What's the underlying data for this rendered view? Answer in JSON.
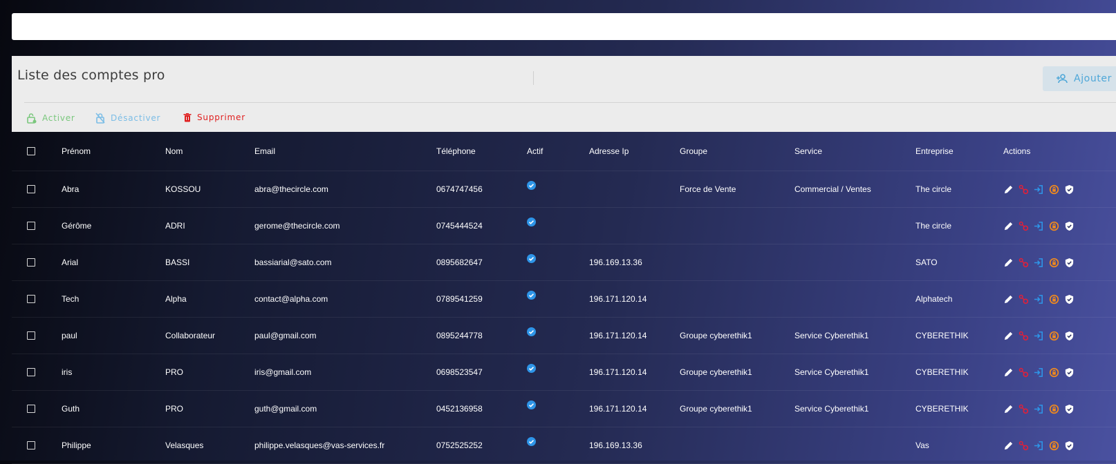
{
  "page": {
    "title": "Liste des comptes pro",
    "add_label": "Ajouter",
    "bulk_actions": {
      "activate": "Activer",
      "deactivate": "Désactiver",
      "delete": "Supprimer"
    }
  },
  "colors": {
    "accent_blue": "#4ea7d8",
    "activate_green": "#7ac77d",
    "delete_red": "#e01e1e",
    "check_blue": "#2e95e8",
    "action_orange": "#f08a1d"
  },
  "table": {
    "headers": {
      "first": "Prénom",
      "last": "Nom",
      "email": "Email",
      "phone": "Téléphone",
      "actif": "Actif",
      "ip": "Adresse Ip",
      "group": "Groupe",
      "service": "Service",
      "company": "Entreprise",
      "actions": "Actions"
    },
    "rows": [
      {
        "first": "Abra",
        "last": "KOSSOU",
        "email": "abra@thecircle.com",
        "phone": "0674747456",
        "actif": true,
        "ip": "",
        "group": "Force de Vente",
        "service": "Commercial / Ventes",
        "company": "The circle"
      },
      {
        "first": "Gérôme",
        "last": "ADRI",
        "email": "gerome@thecircle.com",
        "phone": "0745444524",
        "actif": true,
        "ip": "",
        "group": "",
        "service": "",
        "company": "The circle"
      },
      {
        "first": "Arial",
        "last": "BASSI",
        "email": "bassiarial@sato.com",
        "phone": "0895682647",
        "actif": true,
        "ip": "196.169.13.36",
        "group": "",
        "service": "",
        "company": "SATO"
      },
      {
        "first": "Tech",
        "last": "Alpha",
        "email": "contact@alpha.com",
        "phone": "0789541259",
        "actif": true,
        "ip": "196.171.120.14",
        "group": "",
        "service": "",
        "company": "Alphatech"
      },
      {
        "first": "paul",
        "last": "Collaborateur",
        "email": "paul@gmail.com",
        "phone": "0895244778",
        "actif": true,
        "ip": "196.171.120.14",
        "group": "Groupe cyberethik1",
        "service": "Service Cyberethik1",
        "company": "CYBERETHIK"
      },
      {
        "first": "iris",
        "last": "PRO",
        "email": "iris@gmail.com",
        "phone": "0698523547",
        "actif": true,
        "ip": "196.171.120.14",
        "group": "Groupe cyberethik1",
        "service": "Service Cyberethik1",
        "company": "CYBERETHIK"
      },
      {
        "first": "Guth",
        "last": "PRO",
        "email": "guth@gmail.com",
        "phone": "0452136958",
        "actif": true,
        "ip": "196.171.120.14",
        "group": "Groupe cyberethik1",
        "service": "Service Cyberethik1",
        "company": "CYBERETHIK"
      },
      {
        "first": "Philippe",
        "last": "Velasques",
        "email": "philippe.velasques@vas-services.fr",
        "phone": "0752525252",
        "actif": true,
        "ip": "196.169.13.36",
        "group": "",
        "service": "",
        "company": "Vas"
      }
    ],
    "row_action_icons": [
      "edit-icon",
      "permissions-icon",
      "login-as-icon",
      "reset-icon",
      "security-shield-icon"
    ]
  }
}
